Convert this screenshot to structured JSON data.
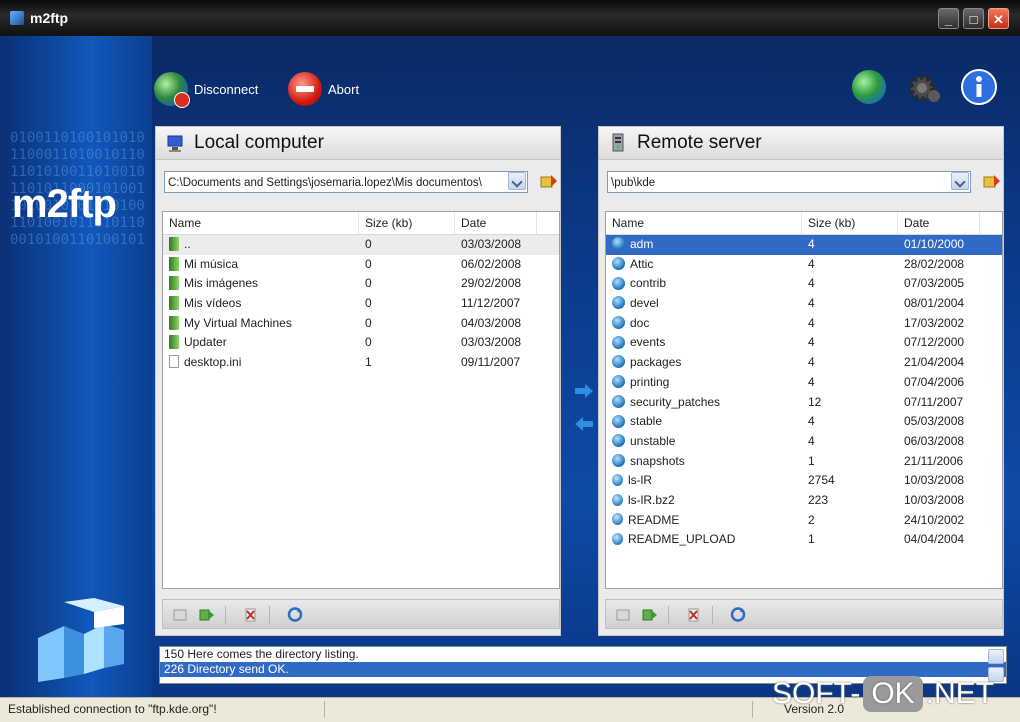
{
  "window": {
    "title": "m2ftp",
    "minimize": "_",
    "maximize": "□",
    "close": "✕"
  },
  "brand": {
    "logo_text": "m2ftp",
    "binary_bg": "0100110100101010110001101001011011010100110100101101011000101001101001010101010011010010110101100010100110100101",
    "colors": {
      "accent": "#316ac5",
      "bg_blue": "#0e4aa8"
    }
  },
  "toolbar": {
    "disconnect_label": "Disconnect",
    "abort_label": "Abort",
    "icons": [
      "globe-refresh-icon",
      "settings-gear-icon",
      "info-icon"
    ]
  },
  "local": {
    "title": "Local computer",
    "path": "C:\\Documents and Settings\\josemaria.lopez\\Mis documentos\\",
    "columns": [
      "Name",
      "Size (kb)",
      "Date"
    ],
    "rows": [
      {
        "name": "..",
        "size": "0",
        "date": "03/03/2008",
        "type": "folder"
      },
      {
        "name": "Mi música",
        "size": "0",
        "date": "06/02/2008",
        "type": "folder"
      },
      {
        "name": "Mis imágenes",
        "size": "0",
        "date": "29/02/2008",
        "type": "folder"
      },
      {
        "name": "Mis vídeos",
        "size": "0",
        "date": "11/12/2007",
        "type": "folder"
      },
      {
        "name": "My Virtual Machines",
        "size": "0",
        "date": "04/03/2008",
        "type": "folder"
      },
      {
        "name": "Updater",
        "size": "0",
        "date": "03/03/2008",
        "type": "folder"
      },
      {
        "name": "desktop.ini",
        "size": "1",
        "date": "09/11/2007",
        "type": "file"
      }
    ]
  },
  "remote": {
    "title": "Remote server",
    "path": "\\pub\\kde",
    "columns": [
      "Name",
      "Size (kb)",
      "Date"
    ],
    "rows": [
      {
        "name": "adm",
        "size": "4",
        "date": "01/10/2000",
        "type": "folder"
      },
      {
        "name": "Attic",
        "size": "4",
        "date": "28/02/2008",
        "type": "folder"
      },
      {
        "name": "contrib",
        "size": "4",
        "date": "07/03/2005",
        "type": "folder"
      },
      {
        "name": "devel",
        "size": "4",
        "date": "08/01/2004",
        "type": "folder"
      },
      {
        "name": "doc",
        "size": "4",
        "date": "17/03/2002",
        "type": "folder"
      },
      {
        "name": "events",
        "size": "4",
        "date": "07/12/2000",
        "type": "folder"
      },
      {
        "name": "packages",
        "size": "4",
        "date": "21/04/2004",
        "type": "folder"
      },
      {
        "name": "printing",
        "size": "4",
        "date": "07/04/2006",
        "type": "folder"
      },
      {
        "name": "security_patches",
        "size": "12",
        "date": "07/11/2007",
        "type": "folder"
      },
      {
        "name": "stable",
        "size": "4",
        "date": "05/03/2008",
        "type": "folder"
      },
      {
        "name": "unstable",
        "size": "4",
        "date": "06/03/2008",
        "type": "folder"
      },
      {
        "name": "snapshots",
        "size": "1",
        "date": "21/11/2006",
        "type": "folder"
      },
      {
        "name": "ls-lR",
        "size": "2754",
        "date": "10/03/2008",
        "type": "file"
      },
      {
        "name": "ls-lR.bz2",
        "size": "223",
        "date": "10/03/2008",
        "type": "file"
      },
      {
        "name": "README",
        "size": "2",
        "date": "24/10/2002",
        "type": "file"
      },
      {
        "name": "README_UPLOAD",
        "size": "1",
        "date": "04/04/2004",
        "type": "file"
      }
    ]
  },
  "log": {
    "lines": [
      "150 Here comes the directory listing.",
      "226 Directory send OK."
    ]
  },
  "status": {
    "message": "Established connection to \"ftp.kde.org\"!",
    "version": "Version 2.0"
  },
  "watermark": {
    "left": "SOFT-",
    "ok": "OK",
    "right": ".NET"
  }
}
